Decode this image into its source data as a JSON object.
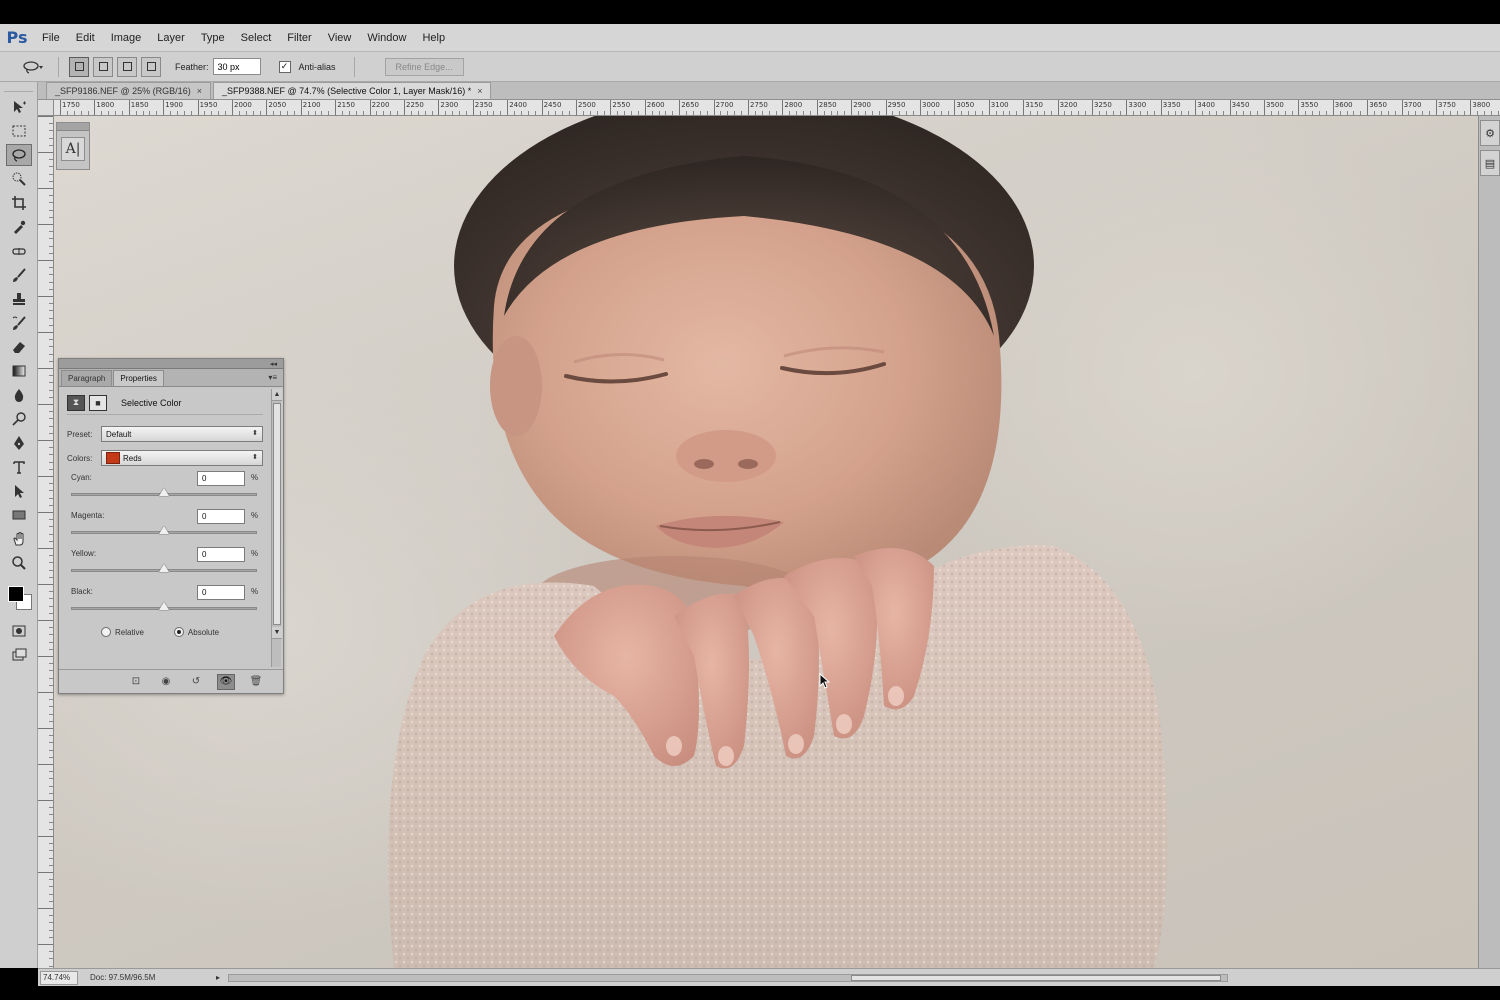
{
  "app": {
    "logo": "Ps"
  },
  "menu": [
    "File",
    "Edit",
    "Image",
    "Layer",
    "Type",
    "Select",
    "Filter",
    "View",
    "Window",
    "Help"
  ],
  "options": {
    "feather_label": "Feather:",
    "feather_value": "30 px",
    "antialias_label": "Anti-alias",
    "antialias_checked": true,
    "refine_label": "Refine Edge..."
  },
  "tabs": [
    {
      "label": "_SFP9186.NEF @ 25% (RGB/16)",
      "active": false
    },
    {
      "label": "_SFP9388.NEF @ 74.7% (Selective Color 1, Layer Mask/16) *",
      "active": true
    }
  ],
  "ruler": {
    "top_labels": [
      "1750",
      "1800",
      "1850",
      "1900",
      "1950",
      "2000",
      "2050",
      "2100",
      "2150",
      "2200",
      "2250",
      "2300",
      "2350",
      "2400",
      "2450",
      "2500",
      "2550",
      "2600",
      "2650",
      "2700",
      "2750",
      "2800",
      "2850",
      "2900",
      "2950",
      "3000",
      "3050",
      "3100",
      "3150",
      "3200",
      "3250",
      "3300",
      "3350",
      "3400",
      "3450",
      "3500",
      "3550",
      "3600",
      "3650",
      "3700",
      "3750",
      "3800"
    ]
  },
  "panel": {
    "tabs": [
      "Paragraph",
      "Properties"
    ],
    "active_tab": "Properties",
    "title": "Selective Color",
    "preset_label": "Preset:",
    "preset_value": "Default",
    "colors_label": "Colors:",
    "colors_value": "Reds",
    "colors_swatch": "#c43a18",
    "sliders": [
      {
        "label": "Cyan:",
        "value": "0",
        "unit": "%",
        "fraction": 0.5
      },
      {
        "label": "Magenta:",
        "value": "0",
        "unit": "%",
        "fraction": 0.5
      },
      {
        "label": "Yellow:",
        "value": "0",
        "unit": "%",
        "fraction": 0.5
      },
      {
        "label": "Black:",
        "value": "0",
        "unit": "%",
        "fraction": 0.5
      }
    ],
    "method_relative": "Relative",
    "method_absolute": "Absolute",
    "method_selected": "Absolute"
  },
  "status": {
    "zoom": "74.74%",
    "doc_info": "Doc: 97.5M/96.5M"
  },
  "colors": {
    "foreground": "#000000",
    "background": "#ffffff"
  }
}
